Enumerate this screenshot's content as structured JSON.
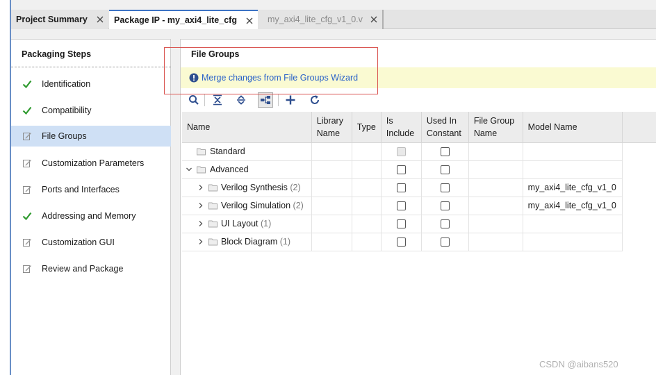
{
  "tabs": [
    {
      "label": "Project Summary",
      "active": false
    },
    {
      "label": "Package IP - my_axi4_lite_cfg",
      "active": true
    },
    {
      "label": "my_axi4_lite_cfg_v1_0.v",
      "active": false
    }
  ],
  "steps_panel": {
    "title": "Packaging Steps",
    "items": [
      {
        "label": "Identification",
        "icon": "check-icon"
      },
      {
        "label": "Compatibility",
        "icon": "check-icon"
      },
      {
        "label": "File Groups",
        "icon": "edit-icon",
        "selected": true
      },
      {
        "label": "Customization Parameters",
        "icon": "edit-icon"
      },
      {
        "label": "Ports and Interfaces",
        "icon": "edit-icon"
      },
      {
        "label": "Addressing and Memory",
        "icon": "check-icon"
      },
      {
        "label": "Customization GUI",
        "icon": "edit-icon"
      },
      {
        "label": "Review and Package",
        "icon": "edit-icon"
      }
    ]
  },
  "main": {
    "title": "File Groups",
    "banner": {
      "link": "Merge changes from File Groups Wizard",
      "icon": "info-icon"
    },
    "toolbar": [
      "search-icon",
      "collapse-all-icon",
      "expand-all-icon",
      "hierarchy-icon",
      "add-icon",
      "refresh-icon"
    ],
    "table": {
      "columns": [
        {
          "l1": "Name",
          "l2": ""
        },
        {
          "l1": "Library",
          "l2": "Name"
        },
        {
          "l1": "Type",
          "l2": ""
        },
        {
          "l1": "Is",
          "l2": "Include"
        },
        {
          "l1": "Used In",
          "l2": "Constant"
        },
        {
          "l1": "File Group",
          "l2": "Name"
        },
        {
          "l1": "Model Name",
          "l2": ""
        }
      ],
      "rows": [
        {
          "name": "Standard",
          "count": "",
          "model": ""
        },
        {
          "name": "Advanced",
          "count": "",
          "model": ""
        },
        {
          "name": "Verilog Synthesis",
          "count": "(2)",
          "model": "my_axi4_lite_cfg_v1_0"
        },
        {
          "name": "Verilog Simulation",
          "count": "(2)",
          "model": "my_axi4_lite_cfg_v1_0"
        },
        {
          "name": "UI Layout",
          "count": "(1)",
          "model": ""
        },
        {
          "name": "Block Diagram",
          "count": "(1)",
          "model": ""
        }
      ]
    }
  },
  "colors": {
    "accent": "#3c73c4",
    "selected_row": "#cfe0f5",
    "banner": "#fafad2",
    "link": "#2a62c9",
    "check": "#2e9a2e",
    "highlight": "#d9534f"
  },
  "watermark": "CSDN @aibans520"
}
